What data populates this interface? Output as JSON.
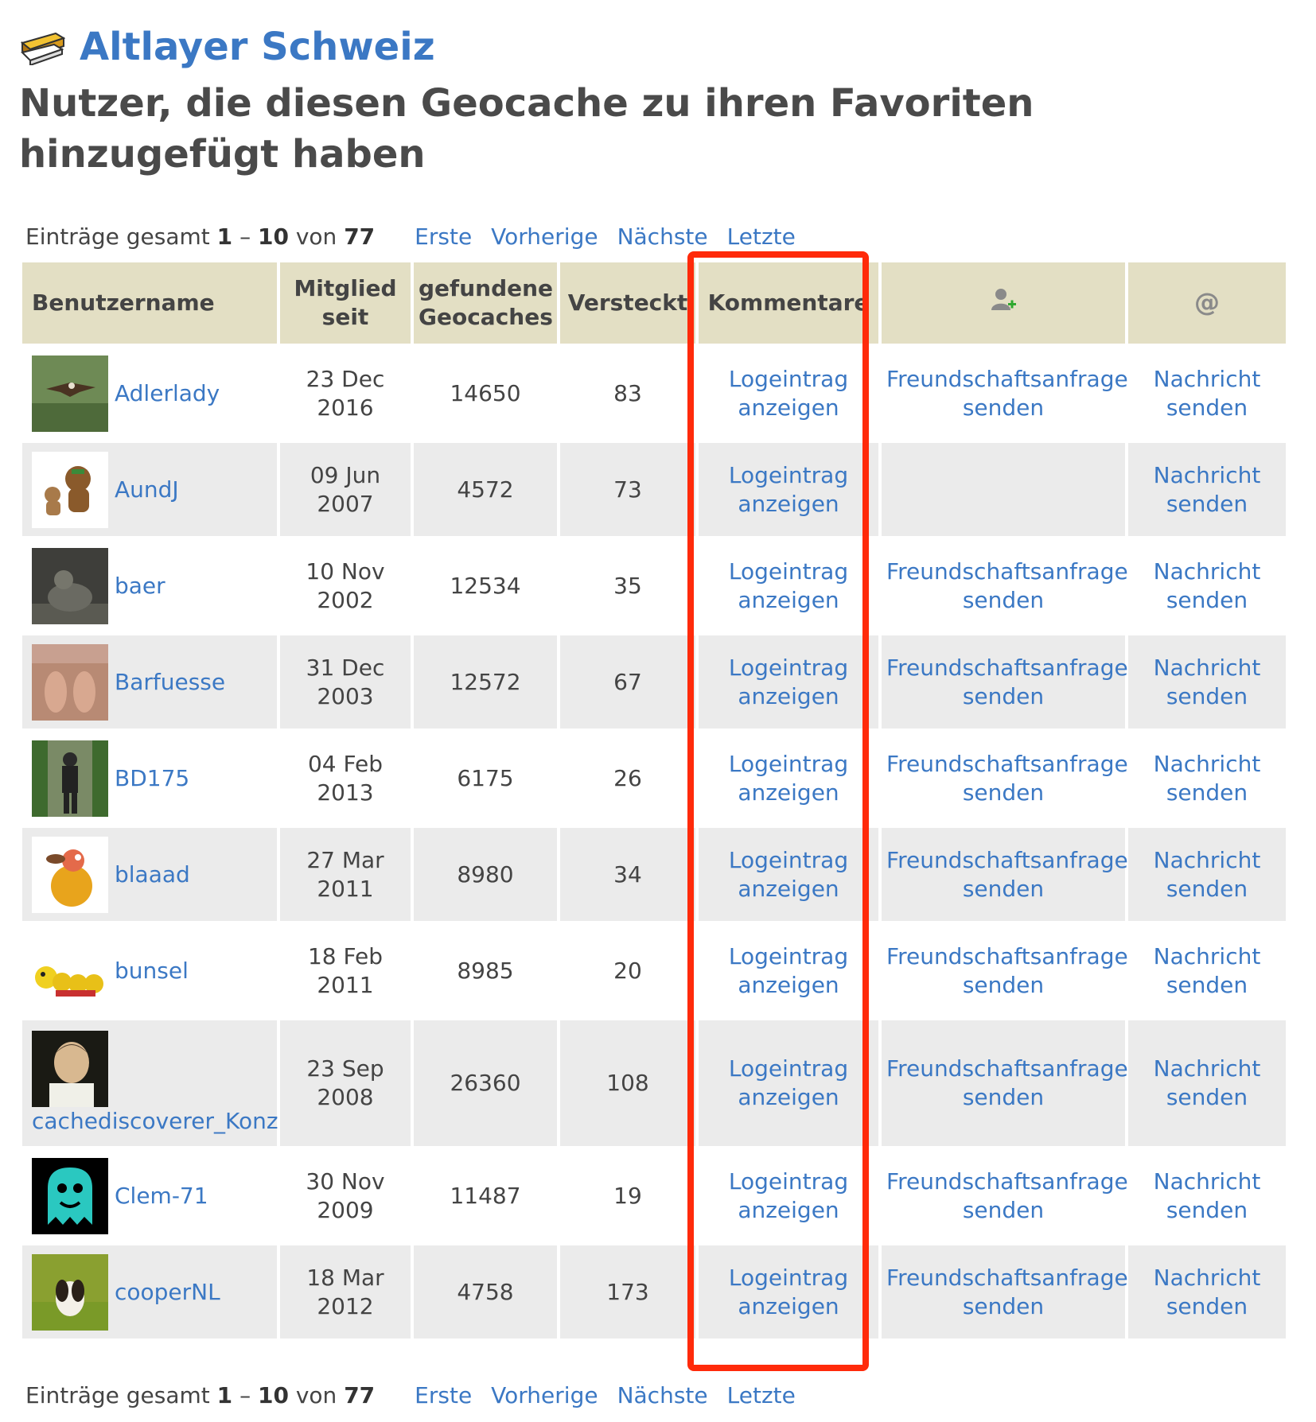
{
  "header": {
    "cache_name": "Altlayer Schweiz",
    "page_title": "Nutzer, die diesen Geocache zu ihren Favoriten hinzugefügt haben"
  },
  "pagination": {
    "prefix": "Einträge gesamt",
    "range_start": "1",
    "dash": "–",
    "range_end": "10",
    "of": "von",
    "total": "77",
    "first": "Erste",
    "previous": "Vorherige",
    "next": "Nächste",
    "last": "Letzte"
  },
  "table": {
    "headers": {
      "username": "Benutzername",
      "member_since": "Mitglied seit",
      "found": "gefundene Geocaches",
      "hidden": "Versteckt",
      "comments": "Kommentare",
      "friend_icon": "add-friend-icon",
      "message_icon": "at-icon"
    },
    "rows": [
      {
        "username": "Adlerlady",
        "member_since": "23 Dec 2016",
        "found": "14650",
        "hidden": "83",
        "log_link": "Logeintrag anzeigen",
        "friend_link": "Freundschaftsanfrage senden",
        "message_link": "Nachricht senden",
        "avatar": "eagle-avatar"
      },
      {
        "username": "AundJ",
        "member_since": "09 Jun 2007",
        "found": "4572",
        "hidden": "73",
        "log_link": "Logeintrag anzeigen",
        "friend_link": "",
        "message_link": "Nachricht senden",
        "avatar": "cartoon-bears-avatar"
      },
      {
        "username": "baer",
        "member_since": "10 Nov 2002",
        "found": "12534",
        "hidden": "35",
        "log_link": "Logeintrag anzeigen",
        "friend_link": "Freundschaftsanfrage senden",
        "message_link": "Nachricht senden",
        "avatar": "bear-statue-avatar"
      },
      {
        "username": "Barfuesse",
        "member_since": "31 Dec 2003",
        "found": "12572",
        "hidden": "67",
        "log_link": "Logeintrag anzeigen",
        "friend_link": "Freundschaftsanfrage senden",
        "message_link": "Nachricht senden",
        "avatar": "feet-avatar"
      },
      {
        "username": "BD175",
        "member_since": "04 Feb 2013",
        "found": "6175",
        "hidden": "26",
        "log_link": "Logeintrag anzeigen",
        "friend_link": "Freundschaftsanfrage senden",
        "message_link": "Nachricht senden",
        "avatar": "hiker-avatar"
      },
      {
        "username": "blaaad",
        "member_since": "27 Mar 2011",
        "found": "8980",
        "hidden": "34",
        "log_link": "Logeintrag anzeigen",
        "friend_link": "Freundschaftsanfrage senden",
        "message_link": "Nachricht senden",
        "avatar": "cartoon-dog-avatar"
      },
      {
        "username": "bunsel",
        "member_since": "18 Feb 2011",
        "found": "8985",
        "hidden": "20",
        "log_link": "Logeintrag anzeigen",
        "friend_link": "Freundschaftsanfrage senden",
        "message_link": "Nachricht senden",
        "avatar": "caterpillar-avatar"
      },
      {
        "username": "cachediscoverer_Konz",
        "member_since": "23 Sep 2008",
        "found": "26360",
        "hidden": "108",
        "log_link": "Logeintrag anzeigen",
        "friend_link": "Freundschaftsanfrage senden",
        "message_link": "Nachricht senden",
        "avatar": "portrait-avatar"
      },
      {
        "username": "Clem-71",
        "member_since": "30 Nov 2009",
        "found": "11487",
        "hidden": "19",
        "log_link": "Logeintrag anzeigen",
        "friend_link": "Freundschaftsanfrage senden",
        "message_link": "Nachricht senden",
        "avatar": "ghost-avatar"
      },
      {
        "username": "cooperNL",
        "member_since": "18 Mar 2012",
        "found": "4758",
        "hidden": "173",
        "log_link": "Logeintrag anzeigen",
        "friend_link": "Freundschaftsanfrage senden",
        "message_link": "Nachricht senden",
        "avatar": "dog-in-grass-avatar"
      }
    ]
  },
  "colors": {
    "link": "#3b78c4",
    "header_bg": "#e3dfc4",
    "row_alt_bg": "#ebebeb",
    "highlight_border": "#ff2a0a"
  }
}
